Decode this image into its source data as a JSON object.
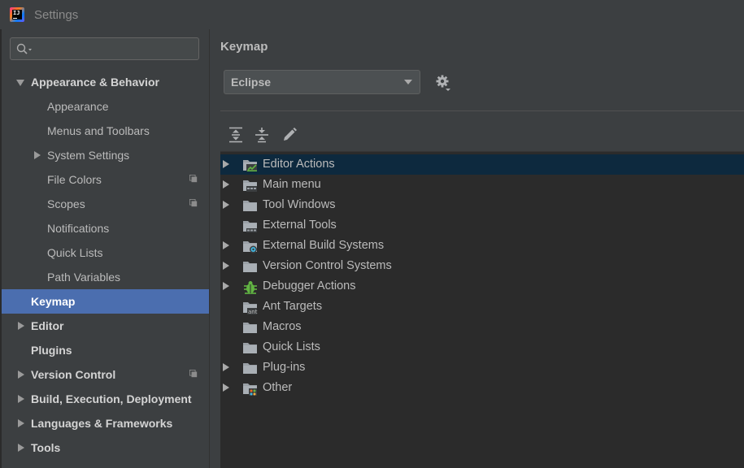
{
  "window": {
    "title": "Settings"
  },
  "search": {
    "placeholder": ""
  },
  "sidebar": {
    "items": [
      {
        "label": "Appearance & Behavior",
        "bold": true,
        "arrow": "down"
      },
      {
        "label": "Appearance",
        "bold": false,
        "arrow": "none"
      },
      {
        "label": "Menus and Toolbars",
        "bold": false,
        "arrow": "none"
      },
      {
        "label": "System Settings",
        "bold": false,
        "arrow": "right"
      },
      {
        "label": "File Colors",
        "bold": false,
        "arrow": "none",
        "project_icon": true
      },
      {
        "label": "Scopes",
        "bold": false,
        "arrow": "none",
        "project_icon": true
      },
      {
        "label": "Notifications",
        "bold": false,
        "arrow": "none"
      },
      {
        "label": "Quick Lists",
        "bold": false,
        "arrow": "none"
      },
      {
        "label": "Path Variables",
        "bold": false,
        "arrow": "none"
      },
      {
        "label": "Keymap",
        "bold": true,
        "arrow": "none",
        "selected": true
      },
      {
        "label": "Editor",
        "bold": true,
        "arrow": "right"
      },
      {
        "label": "Plugins",
        "bold": true,
        "arrow": "none"
      },
      {
        "label": "Version Control",
        "bold": true,
        "arrow": "right",
        "project_icon": true
      },
      {
        "label": "Build, Execution, Deployment",
        "bold": true,
        "arrow": "right"
      },
      {
        "label": "Languages & Frameworks",
        "bold": true,
        "arrow": "right"
      },
      {
        "label": "Tools",
        "bold": true,
        "arrow": "right"
      }
    ]
  },
  "main": {
    "title": "Keymap",
    "keymap_select": {
      "value": "Eclipse"
    },
    "toolbar": {
      "icons": [
        "expand-all-icon",
        "collapse-all-icon",
        "edit-icon"
      ]
    },
    "tree": [
      {
        "label": "Editor Actions",
        "expandable": true,
        "icon": "editor-actions-folder-icon",
        "selected": true
      },
      {
        "label": "Main menu",
        "expandable": true,
        "icon": "main-menu-folder-icon"
      },
      {
        "label": "Tool Windows",
        "expandable": true,
        "icon": "folder-icon"
      },
      {
        "label": "External Tools",
        "expandable": false,
        "icon": "external-tools-folder-icon"
      },
      {
        "label": "External Build Systems",
        "expandable": true,
        "icon": "build-systems-folder-icon"
      },
      {
        "label": "Version Control Systems",
        "expandable": true,
        "icon": "folder-icon"
      },
      {
        "label": "Debugger Actions",
        "expandable": true,
        "icon": "bug-icon"
      },
      {
        "label": "Ant Targets",
        "expandable": false,
        "icon": "ant-folder-icon"
      },
      {
        "label": "Macros",
        "expandable": false,
        "icon": "folder-icon"
      },
      {
        "label": "Quick Lists",
        "expandable": false,
        "icon": "folder-icon"
      },
      {
        "label": "Plug-ins",
        "expandable": true,
        "icon": "folder-icon"
      },
      {
        "label": "Other",
        "expandable": true,
        "icon": "other-folder-icon"
      }
    ]
  },
  "colors": {
    "background": "#3c3f41",
    "tree_background": "#2b2b2b",
    "selection": "#4b6eaf",
    "tree_selection": "#0d293e"
  }
}
